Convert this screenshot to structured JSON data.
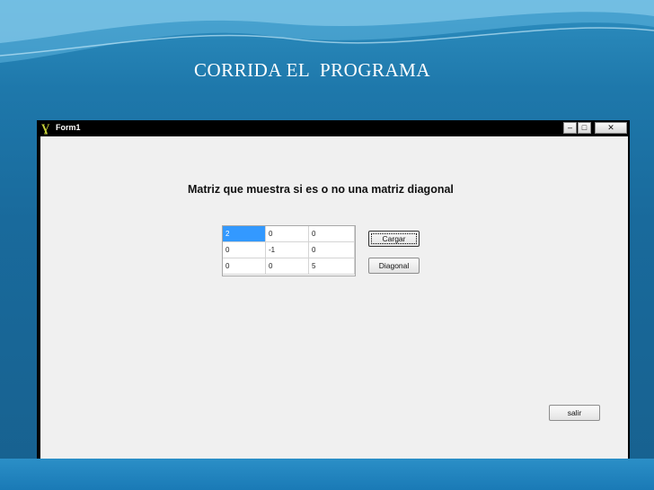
{
  "slide": {
    "title": "CORRIDA EL  PROGRAMA"
  },
  "window": {
    "title": "Form1",
    "icon": "delphi-app-icon",
    "controls": {
      "minimize": "–",
      "maximize": "□",
      "close": "✕"
    }
  },
  "form": {
    "heading": "Matriz que muestra si es o no una matriz diagonal",
    "matrix": [
      [
        "2",
        "0",
        "0"
      ],
      [
        "0",
        "-1",
        "0"
      ],
      [
        "0",
        "0",
        "5"
      ]
    ],
    "buttons": {
      "cargar": "Cargar",
      "diagonal": "Diagonal",
      "salir": "salir"
    }
  },
  "colors": {
    "slide_bg": "#196a9c",
    "selection": "#3399ff",
    "form_bg": "#f0f0f0"
  }
}
